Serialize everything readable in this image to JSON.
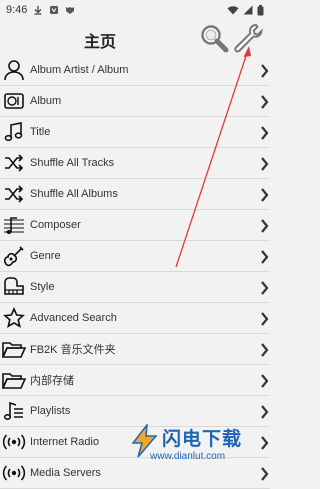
{
  "status_bar": {
    "time": "9:46"
  },
  "header": {
    "title": "主页"
  },
  "menu_items": [
    {
      "label": "Album Artist / Album",
      "icon": "person-icon"
    },
    {
      "label": "Album",
      "icon": "album-icon"
    },
    {
      "label": "Title",
      "icon": "music-note-icon"
    },
    {
      "label": "Shuffle All Tracks",
      "icon": "shuffle-icon"
    },
    {
      "label": "Shuffle All Albums",
      "icon": "shuffle-icon"
    },
    {
      "label": "Composer",
      "icon": "composer-icon"
    },
    {
      "label": "Genre",
      "icon": "guitar-icon"
    },
    {
      "label": "Style",
      "icon": "piano-icon"
    },
    {
      "label": "Advanced Search",
      "icon": "star-icon"
    },
    {
      "label": "FB2K 音乐文件夹",
      "icon": "folder-icon"
    },
    {
      "label": "内部存储",
      "icon": "folder-icon"
    },
    {
      "label": "Playlists",
      "icon": "playlist-icon"
    },
    {
      "label": "Internet Radio",
      "icon": "radio-icon"
    },
    {
      "label": "Media Servers",
      "icon": "radio-icon"
    }
  ],
  "watermark": {
    "title": "闪电下载",
    "url": "www.dianlut.com"
  },
  "colors": {
    "annotation": "#e53935",
    "watermark": "#1e66b5"
  }
}
